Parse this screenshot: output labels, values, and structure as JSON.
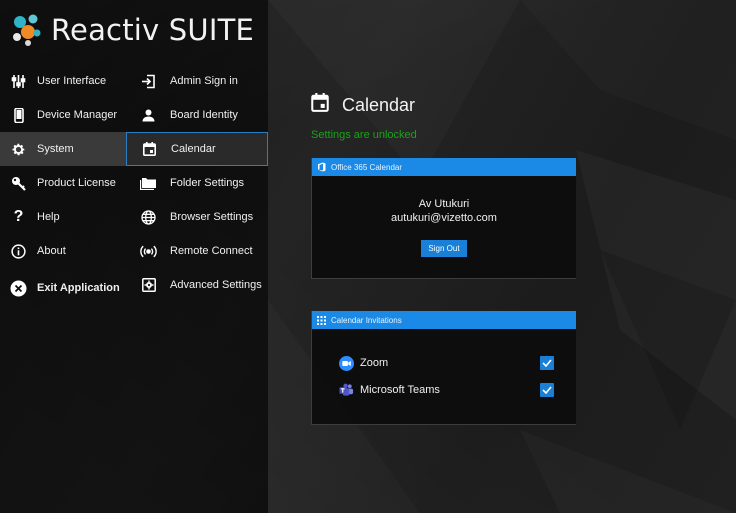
{
  "brand": {
    "title": "Reactiv SUITE"
  },
  "nav": {
    "column1": [
      {
        "label": "User Interface",
        "icon": "sliders-icon"
      },
      {
        "label": "Device Manager",
        "icon": "phone-icon"
      },
      {
        "label": "System",
        "icon": "gear-icon",
        "active": true
      },
      {
        "label": "Product License",
        "icon": "key-icon"
      },
      {
        "label": "Help",
        "icon": "question-mark-icon"
      },
      {
        "label": "About",
        "icon": "info-icon"
      },
      {
        "label": "Exit Application",
        "icon": "close-circle-icon"
      }
    ],
    "column2": [
      {
        "label": "Admin Sign in",
        "icon": "sign-in-icon"
      },
      {
        "label": "Board Identity",
        "icon": "person-icon"
      },
      {
        "label": "Calendar",
        "icon": "calendar-icon",
        "active": true
      },
      {
        "label": "Folder Settings",
        "icon": "folder-icon"
      },
      {
        "label": "Browser Settings",
        "icon": "globe-icon"
      },
      {
        "label": "Remote Connect",
        "icon": "broadcast-icon"
      },
      {
        "label": "Advanced Settings",
        "icon": "settings-box-icon"
      }
    ]
  },
  "page": {
    "title": "Calendar",
    "status": "Settings are unlocked"
  },
  "office365": {
    "header": "Office 365 Calendar",
    "user_name": "Av Utukuri",
    "user_email": "autukuri@vizetto.com",
    "sign_out_label": "Sign Out"
  },
  "invitations": {
    "header": "Calendar Invitations",
    "items": [
      {
        "label": "Zoom",
        "icon": "zoom-icon",
        "checked": true
      },
      {
        "label": "Microsoft Teams",
        "icon": "teams-icon",
        "checked": true
      }
    ]
  },
  "colors": {
    "accent": "#1a8ae6",
    "status_green": "#19a319",
    "active_border": "#2a7fc4"
  }
}
